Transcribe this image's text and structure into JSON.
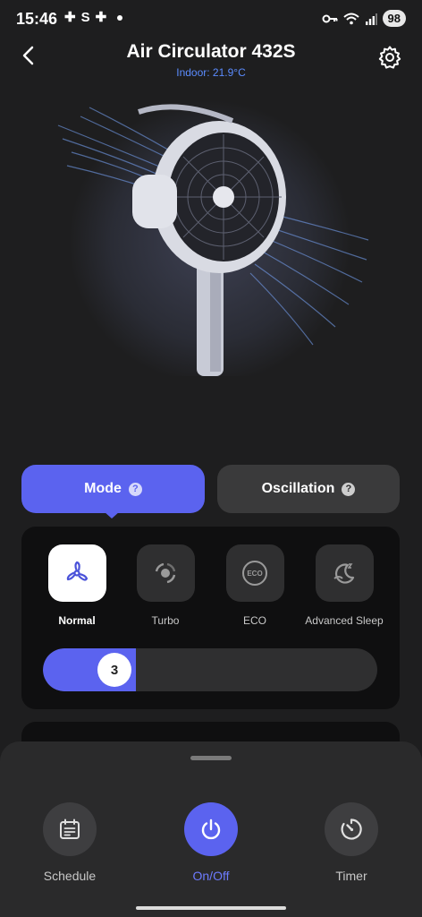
{
  "status_bar": {
    "time": "15:46",
    "left_icons": [
      "notification-icon",
      "s-icon",
      "notification-icon",
      "dot"
    ],
    "right_icons": [
      "key-icon",
      "wifi-icon",
      "signal-icon"
    ],
    "battery": "98"
  },
  "header": {
    "title": "Air Circulator 432S",
    "subtitle": "Indoor: 21.9°C"
  },
  "tabs": [
    {
      "label": "Mode",
      "active": true
    },
    {
      "label": "Oscillation",
      "active": false
    }
  ],
  "help_glyph": "?",
  "modes": [
    {
      "label": "Normal",
      "icon": "fan-icon",
      "active": true
    },
    {
      "label": "Turbo",
      "icon": "turbo-icon",
      "active": false
    },
    {
      "label": "ECO",
      "icon": "eco-icon",
      "active": false
    },
    {
      "label": "Advanced Sleep",
      "icon": "sleep-icon",
      "active": false
    }
  ],
  "eco_badge": "ECO",
  "fan_speed": {
    "value": "3",
    "level": 3,
    "max": 12
  },
  "actions": [
    {
      "label": "Schedule",
      "icon": "calendar-icon"
    },
    {
      "label": "On/Off",
      "icon": "power-icon"
    },
    {
      "label": "Timer",
      "icon": "timer-icon"
    }
  ],
  "colors": {
    "accent": "#5b63ef",
    "subtitle": "#5b8cff",
    "background": "#1e1e1f"
  }
}
